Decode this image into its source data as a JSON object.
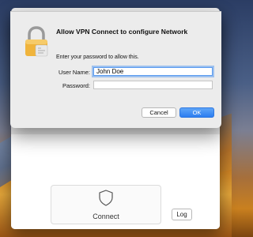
{
  "dialog": {
    "title": "Allow VPN Connect to configure Network",
    "prompt": "Enter your password to allow this.",
    "username_label": "User Name:",
    "username_value": "John Doe",
    "password_label": "Password:",
    "password_value": "",
    "cancel_label": "Cancel",
    "ok_label": "OK"
  },
  "app": {
    "connect_label": "Connect",
    "log_label": "Log"
  },
  "icons": {
    "dialog_icon": "lock-icon",
    "connect_icon": "shield-icon"
  },
  "colors": {
    "accent": "#2c7df0",
    "lock_gold": "#f0b43c"
  }
}
